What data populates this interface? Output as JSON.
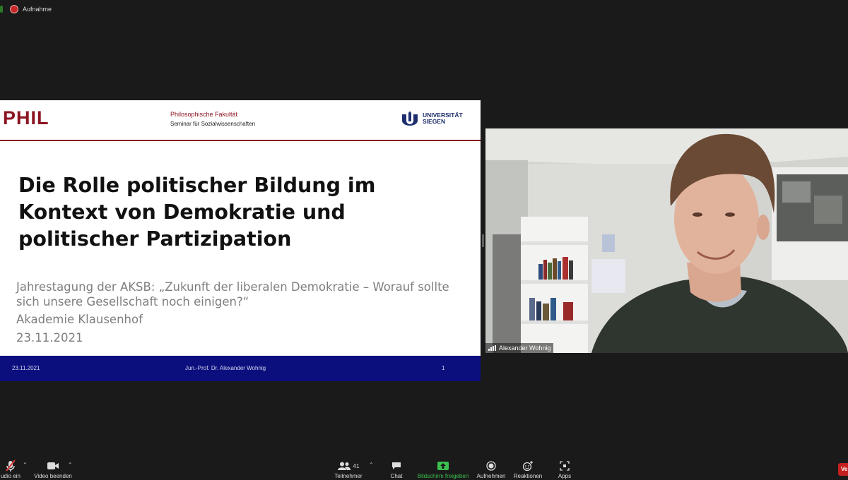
{
  "recording": {
    "label": "Aufnahme"
  },
  "slide": {
    "logo_text": "PHIL",
    "faculty": "Philosophische Fakultät",
    "seminar": "Seminar für Sozialwissenschaften",
    "university": [
      "UNIVERSITÄT",
      "SIEGEN"
    ],
    "title": "Die Rolle politischer Bildung im Kontext von Demokratie und politischer Partizipation",
    "subtitle_line1": "Jahrestagung der AKSB: „Zukunft der liberalen Demokratie – Worauf sollte",
    "subtitle_line2": "sich unsere Gesellschaft noch einigen?“",
    "venue": "Akademie Klausenhof",
    "date": "23.11.2021",
    "footer": {
      "date": "23.11.2021",
      "author": "Jun.-Prof. Dr. Alexander Wohnig",
      "page": "1"
    }
  },
  "participant": {
    "name": "Alexander Wohnig"
  },
  "toolbar": {
    "audio_label": "udio ein",
    "video_label": "Video beenden",
    "participants_label": "Teilnehmer",
    "participants_count": "41",
    "chat_label": "Chat",
    "share_label": "Bildschirm freigeben",
    "record_label": "Aufnehmen",
    "reactions_label": "Reaktionen",
    "apps_label": "Apps",
    "end_label": "Ve"
  },
  "colors": {
    "slide_accent": "#8b1421",
    "slide_footer": "#0b0f7e",
    "share_green": "#3bbf4f",
    "end_red": "#c61f1f"
  },
  "icons": [
    "mic-muted-icon",
    "video-camera-icon",
    "participants-icon",
    "chat-icon",
    "share-screen-icon",
    "record-icon",
    "reactions-icon",
    "apps-icon"
  ]
}
